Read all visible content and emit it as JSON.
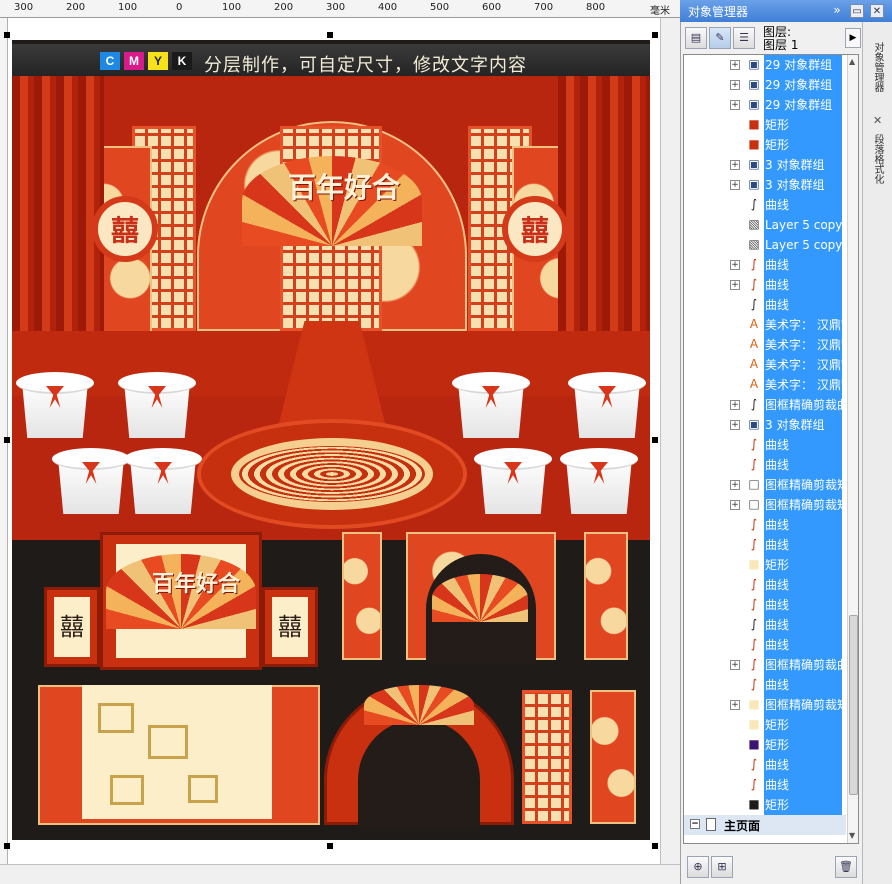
{
  "ruler": {
    "ticks": [
      "300",
      "200",
      "100",
      "0",
      "100",
      "200",
      "300",
      "400",
      "500",
      "600",
      "700",
      "800"
    ],
    "unit": "毫米"
  },
  "canvas": {
    "banner": {
      "cmyk": [
        "C",
        "M",
        "Y",
        "K"
      ],
      "cmyk_colors": [
        "#1e88e5",
        "#d81b8a",
        "#f7e11b",
        "#1a1a1a"
      ],
      "text": "分层制作，可自定尺寸，修改文字内容"
    },
    "fan_text": "百年好合",
    "colors": {
      "red": "#c8300f",
      "cream": "#fbeec9",
      "background": "#1f1b19"
    }
  },
  "dock": {
    "title": "对象管理器",
    "buttons": [
      "»",
      "▭",
      "✕"
    ]
  },
  "object_manager": {
    "layer_line1": "图层:",
    "layer_line2": "图层 1",
    "rows": [
      {
        "label": "29 对象群组",
        "expander": "+",
        "icon": "group-icon",
        "selected": true
      },
      {
        "label": "29 对象群组",
        "expander": "+",
        "icon": "group-icon",
        "selected": true
      },
      {
        "label": "29 对象群组",
        "expander": "+",
        "icon": "group-icon",
        "selected": true
      },
      {
        "label": "矩形",
        "expander": "",
        "icon": "red-rect-icon",
        "selected": true
      },
      {
        "label": "矩形",
        "expander": "",
        "icon": "red-rect-icon",
        "selected": true
      },
      {
        "label": "3 对象群组",
        "expander": "+",
        "icon": "group-icon",
        "selected": true
      },
      {
        "label": "3 对象群组",
        "expander": "+",
        "icon": "group-icon",
        "selected": true
      },
      {
        "label": "曲线",
        "expander": "",
        "icon": "curve-icon",
        "selected": true
      },
      {
        "label": "Layer 5 copy",
        "expander": "",
        "icon": "bitmap-icon",
        "selected": true
      },
      {
        "label": "Layer 5 copy",
        "expander": "",
        "icon": "bitmap-icon",
        "selected": true
      },
      {
        "label": "曲线",
        "expander": "+",
        "icon": "red-curve-icon",
        "selected": true
      },
      {
        "label": "曲线",
        "expander": "+",
        "icon": "red-curve-icon",
        "selected": true
      },
      {
        "label": "曲线",
        "expander": "",
        "icon": "curve-icon",
        "selected": true
      },
      {
        "label": "美术字： 汉鼎繁",
        "expander": "",
        "icon": "text-icon",
        "selected": true
      },
      {
        "label": "美术字： 汉鼎繁",
        "expander": "",
        "icon": "text-icon",
        "selected": true
      },
      {
        "label": "美术字： 汉鼎繁",
        "expander": "",
        "icon": "text-icon",
        "selected": true
      },
      {
        "label": "美术字： 汉鼎繁",
        "expander": "",
        "icon": "text-icon",
        "selected": true
      },
      {
        "label": "图框精确剪裁曲",
        "expander": "+",
        "icon": "curve-icon",
        "selected": true
      },
      {
        "label": "3 对象群组",
        "expander": "+",
        "icon": "group-icon",
        "selected": true
      },
      {
        "label": "曲线",
        "expander": "",
        "icon": "red-curve-icon",
        "selected": true
      },
      {
        "label": "曲线",
        "expander": "",
        "icon": "red-curve-icon",
        "selected": true
      },
      {
        "label": "图框精确剪裁矩",
        "expander": "+",
        "icon": "white-rect-icon",
        "selected": true
      },
      {
        "label": "图框精确剪裁矩",
        "expander": "+",
        "icon": "white-rect-icon",
        "selected": true
      },
      {
        "label": "曲线",
        "expander": "",
        "icon": "red-curve-icon",
        "selected": true
      },
      {
        "label": "曲线",
        "expander": "",
        "icon": "red-curve-icon",
        "selected": true
      },
      {
        "label": "矩形",
        "expander": "",
        "icon": "cream-rect-icon",
        "selected": true
      },
      {
        "label": "曲线",
        "expander": "",
        "icon": "red-curve-icon",
        "selected": true
      },
      {
        "label": "曲线",
        "expander": "",
        "icon": "red-curve-icon",
        "selected": true
      },
      {
        "label": "曲线",
        "expander": "",
        "icon": "curve-icon",
        "selected": true
      },
      {
        "label": "曲线",
        "expander": "",
        "icon": "red-curve-icon",
        "selected": true
      },
      {
        "label": "图框精确剪裁曲",
        "expander": "+",
        "icon": "red-curve-icon",
        "selected": true
      },
      {
        "label": "曲线",
        "expander": "",
        "icon": "red-curve-icon",
        "selected": true
      },
      {
        "label": "图框精确剪裁矩",
        "expander": "+",
        "icon": "cream-rect-icon",
        "selected": true
      },
      {
        "label": "矩形",
        "expander": "",
        "icon": "cream-rect-icon",
        "selected": true
      },
      {
        "label": "矩形",
        "expander": "",
        "icon": "purple-rect-icon",
        "selected": true
      },
      {
        "label": "曲线",
        "expander": "",
        "icon": "red-curve-icon",
        "selected": true
      },
      {
        "label": "曲线",
        "expander": "",
        "icon": "red-curve-icon",
        "selected": true
      },
      {
        "label": "矩形",
        "expander": "",
        "icon": "black-rect-icon",
        "selected": true
      }
    ],
    "master_page": "主页面",
    "side_tabs": [
      "对象管理器",
      "段落格式化"
    ]
  }
}
